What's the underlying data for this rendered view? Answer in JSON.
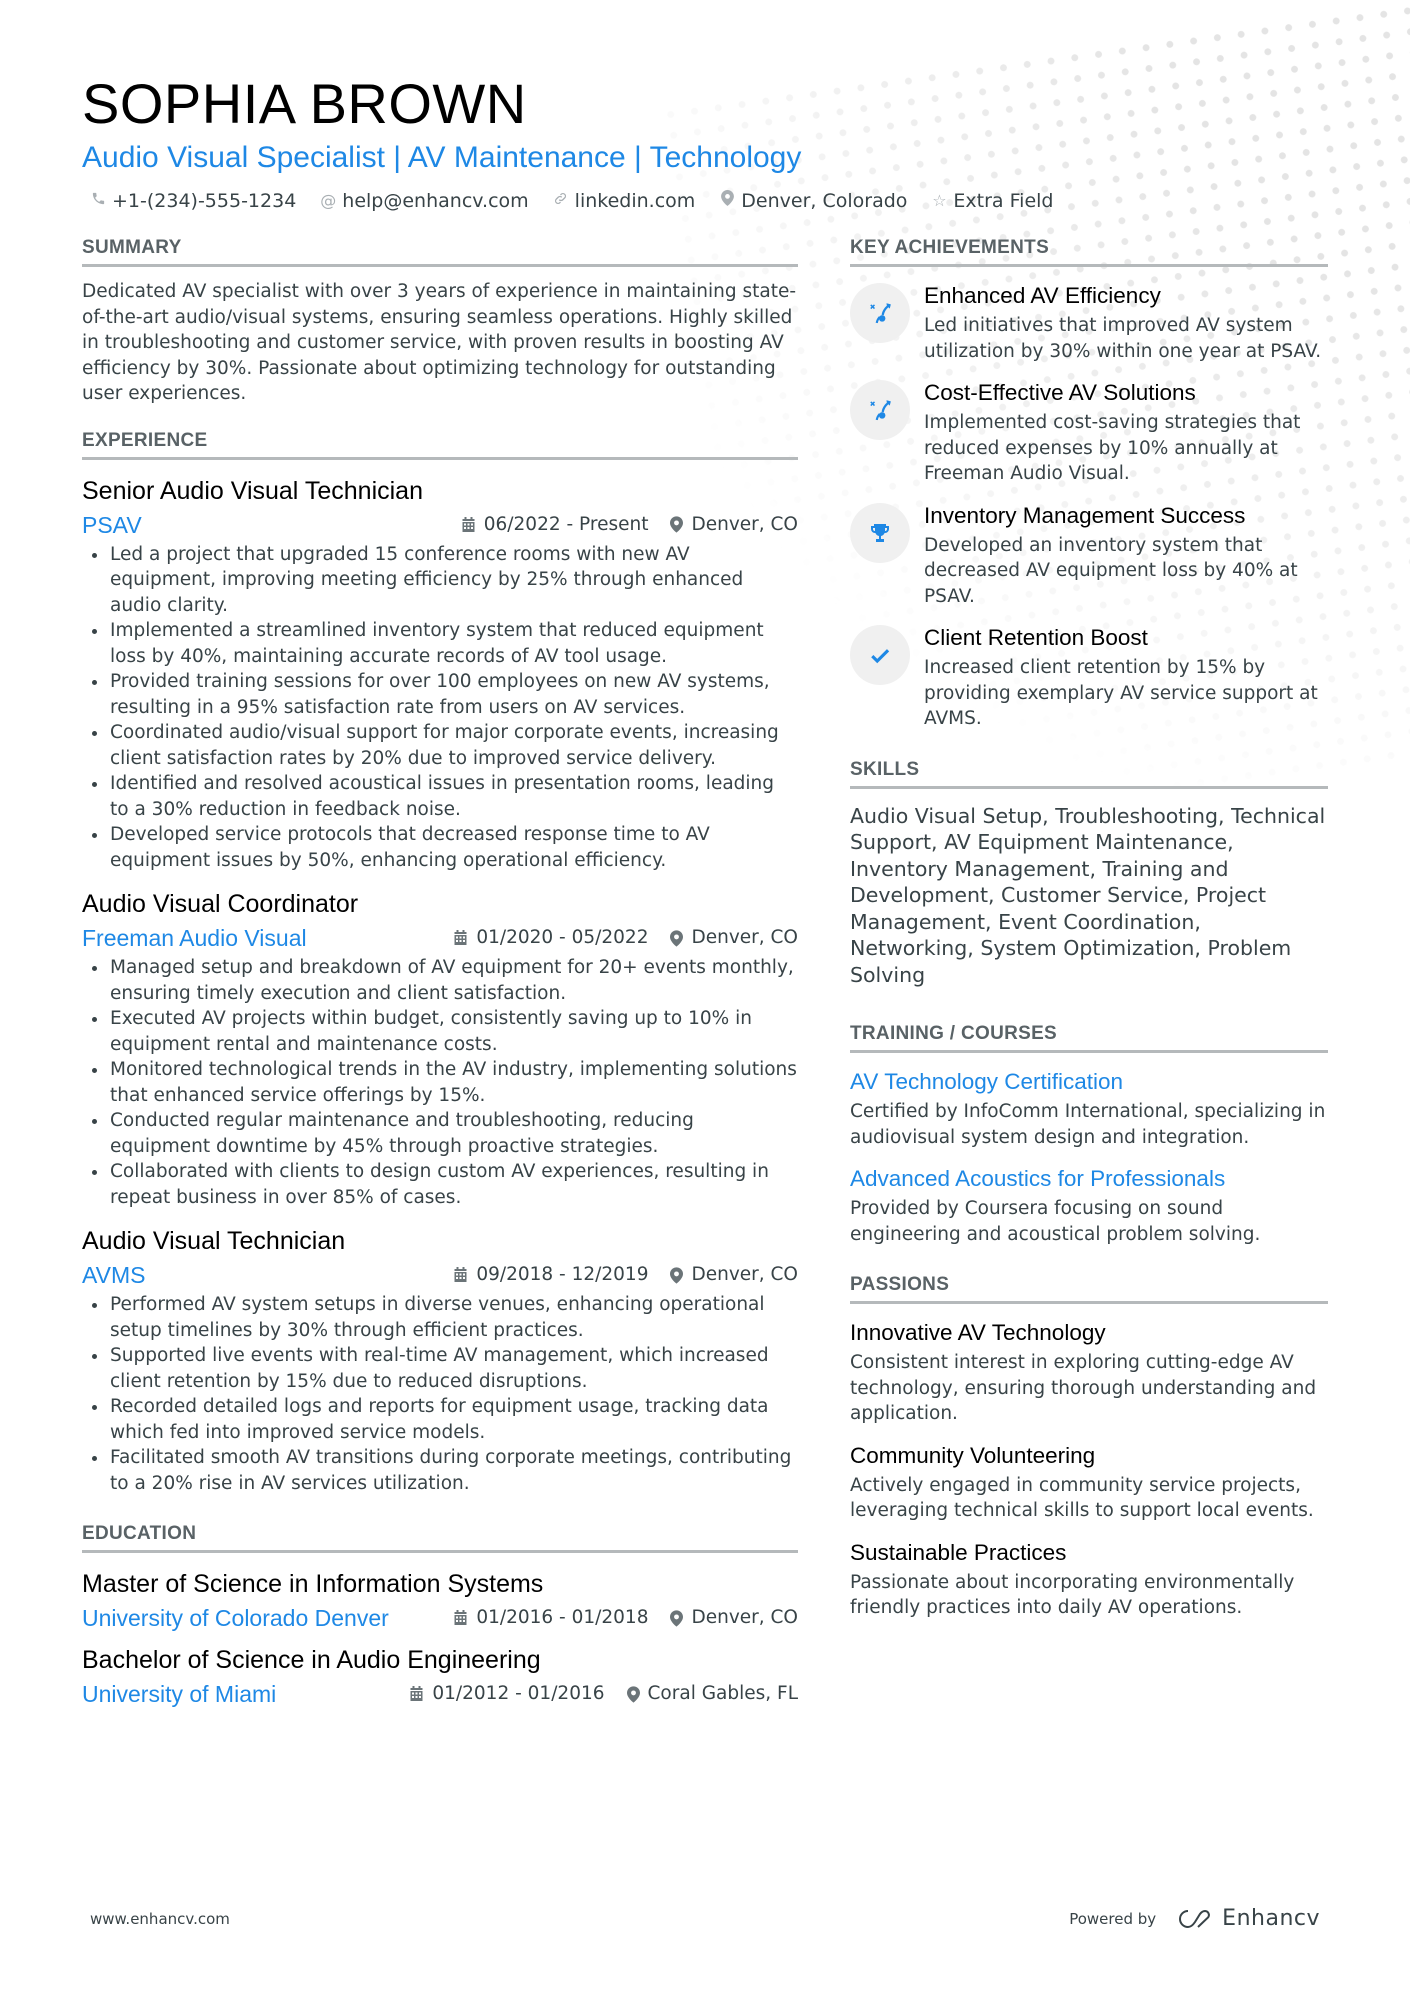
{
  "header": {
    "name": "SOPHIA BROWN",
    "headline": "Audio Visual Specialist | AV Maintenance | Technology",
    "contacts": [
      {
        "icon": "phone-icon",
        "text": "+1-(234)-555-1234"
      },
      {
        "icon": "at-icon",
        "text": "help@enhancv.com"
      },
      {
        "icon": "link-icon",
        "text": "linkedin.com"
      },
      {
        "icon": "location-icon",
        "text": "Denver, Colorado"
      },
      {
        "icon": "star-icon",
        "text": "Extra Field"
      }
    ]
  },
  "summary": {
    "title": "SUMMARY",
    "text": "Dedicated AV specialist with over 3 years of experience in maintaining state-of-the-art audio/visual systems, ensuring seamless operations. Highly skilled in troubleshooting and customer service, with proven results in boosting AV efficiency by 30%. Passionate about optimizing technology for outstanding user experiences."
  },
  "experience": {
    "title": "EXPERIENCE",
    "jobs": [
      {
        "title": "Senior Audio Visual Technician",
        "company": "PSAV",
        "dates": "06/2022 - Present",
        "location": "Denver, CO",
        "bullets": [
          "Led a project that upgraded 15 conference rooms with new AV equipment, improving meeting efficiency by 25% through enhanced audio clarity.",
          "Implemented a streamlined inventory system that reduced equipment loss by 40%, maintaining accurate records of AV tool usage.",
          "Provided training sessions for over 100 employees on new AV systems, resulting in a 95% satisfaction rate from users on AV services.",
          "Coordinated audio/visual support for major corporate events, increasing client satisfaction rates by 20% due to improved service delivery.",
          "Identified and resolved acoustical issues in presentation rooms, leading to a 30% reduction in feedback noise.",
          "Developed service protocols that decreased response time to AV equipment issues by 50%, enhancing operational efficiency."
        ]
      },
      {
        "title": "Audio Visual Coordinator",
        "company": "Freeman Audio Visual",
        "dates": "01/2020 - 05/2022",
        "location": "Denver, CO",
        "bullets": [
          "Managed setup and breakdown of AV equipment for 20+ events monthly, ensuring timely execution and client satisfaction.",
          "Executed AV projects within budget, consistently saving up to 10% in equipment rental and maintenance costs.",
          "Monitored technological trends in the AV industry, implementing solutions that enhanced service offerings by 15%.",
          "Conducted regular maintenance and troubleshooting, reducing equipment downtime by 45% through proactive strategies.",
          "Collaborated with clients to design custom AV experiences, resulting in repeat business in over 85% of cases."
        ]
      },
      {
        "title": "Audio Visual Technician",
        "company": "AVMS",
        "dates": "09/2018 - 12/2019",
        "location": "Denver, CO",
        "bullets": [
          "Performed AV system setups in diverse venues, enhancing operational setup timelines by 30% through efficient practices.",
          "Supported live events with real-time AV management, which increased client retention by 15% due to reduced disruptions.",
          "Recorded detailed logs and reports for equipment usage, tracking data which fed into improved service models.",
          "Facilitated smooth AV transitions during corporate meetings, contributing to a 20% rise in AV services utilization."
        ]
      }
    ]
  },
  "education": {
    "title": "EDUCATION",
    "items": [
      {
        "degree": "Master of Science in Information Systems",
        "school": "University of Colorado Denver",
        "dates": "01/2016 - 01/2018",
        "location": "Denver, CO"
      },
      {
        "degree": "Bachelor of Science in Audio Engineering",
        "school": "University of Miami",
        "dates": "01/2012 - 01/2016",
        "location": "Coral Gables, FL"
      }
    ]
  },
  "achievements": {
    "title": "KEY ACHIEVEMENTS",
    "items": [
      {
        "icon": "strategy-icon",
        "title": "Enhanced AV Efficiency",
        "desc": "Led initiatives that improved AV system utilization by 30% within one year at PSAV."
      },
      {
        "icon": "strategy-icon",
        "title": "Cost-Effective AV Solutions",
        "desc": "Implemented cost-saving strategies that reduced expenses by 10% annually at Freeman Audio Visual."
      },
      {
        "icon": "trophy-icon",
        "title": "Inventory Management Success",
        "desc": "Developed an inventory system that decreased AV equipment loss by 40% at PSAV."
      },
      {
        "icon": "checkmark-icon",
        "title": "Client Retention Boost",
        "desc": "Increased client retention by 15% by providing exemplary AV service support at AVMS."
      }
    ]
  },
  "skills": {
    "title": "SKILLS",
    "text": "Audio Visual Setup, Troubleshooting, Technical Support, AV Equipment Maintenance, Inventory Management, Training and Development, Customer Service, Project Management, Event Coordination, Networking, System Optimization, Problem Solving"
  },
  "training": {
    "title": "TRAINING / COURSES",
    "items": [
      {
        "title": "AV Technology Certification",
        "desc": "Certified by InfoComm International, specializing in audiovisual system design and integration."
      },
      {
        "title": "Advanced Acoustics for Professionals",
        "desc": "Provided by Coursera focusing on sound engineering and acoustical problem solving."
      }
    ]
  },
  "passions": {
    "title": "PASSIONS",
    "items": [
      {
        "title": "Innovative AV Technology",
        "desc": "Consistent interest in exploring cutting-edge AV technology, ensuring thorough understanding and application."
      },
      {
        "title": "Community Volunteering",
        "desc": "Actively engaged in community service projects, leveraging technical skills to support local events."
      },
      {
        "title": "Sustainable Practices",
        "desc": "Passionate about incorporating environmentally friendly practices into daily AV operations."
      }
    ]
  },
  "footer": {
    "website": "www.enhancv.com",
    "powered_by": "Powered by",
    "brand": "Enhancv"
  },
  "colors": {
    "accent": "#1e88e5",
    "text": "#384347",
    "heading": "#000000",
    "rule": "#b5b9bb",
    "icon_bg": "#f0f0f0"
  }
}
